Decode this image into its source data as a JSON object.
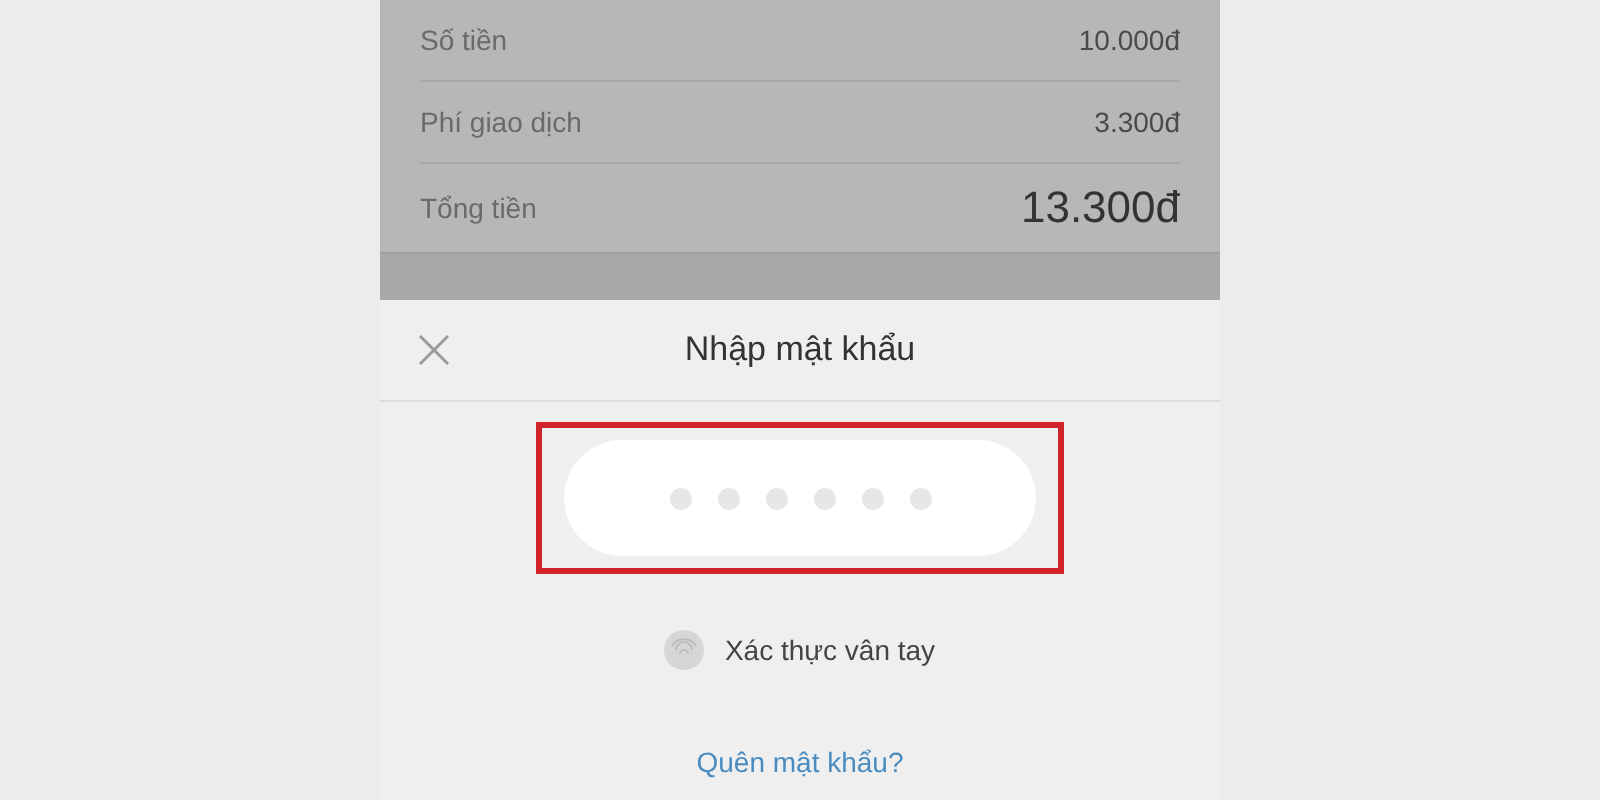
{
  "summary_rows": [
    {
      "label": "Số tiền",
      "value": "10.000đ",
      "kind": "normal"
    },
    {
      "label": "Phí giao dịch",
      "value": "3.300đ",
      "kind": "normal"
    },
    {
      "label": "Tổng tiền",
      "value": "13.300đ",
      "kind": "total"
    }
  ],
  "dialog": {
    "title": "Nhập mật khẩu",
    "password_field": {
      "highlighted": true,
      "dots": [
        {
          "filled": false
        },
        {
          "filled": false
        },
        {
          "filled": false
        },
        {
          "filled": false
        },
        {
          "filled": false
        },
        {
          "filled": false
        }
      ]
    },
    "fingerprint_label": "Xác thực vân tay",
    "forgot_link": "Quên mật khẩu?"
  }
}
